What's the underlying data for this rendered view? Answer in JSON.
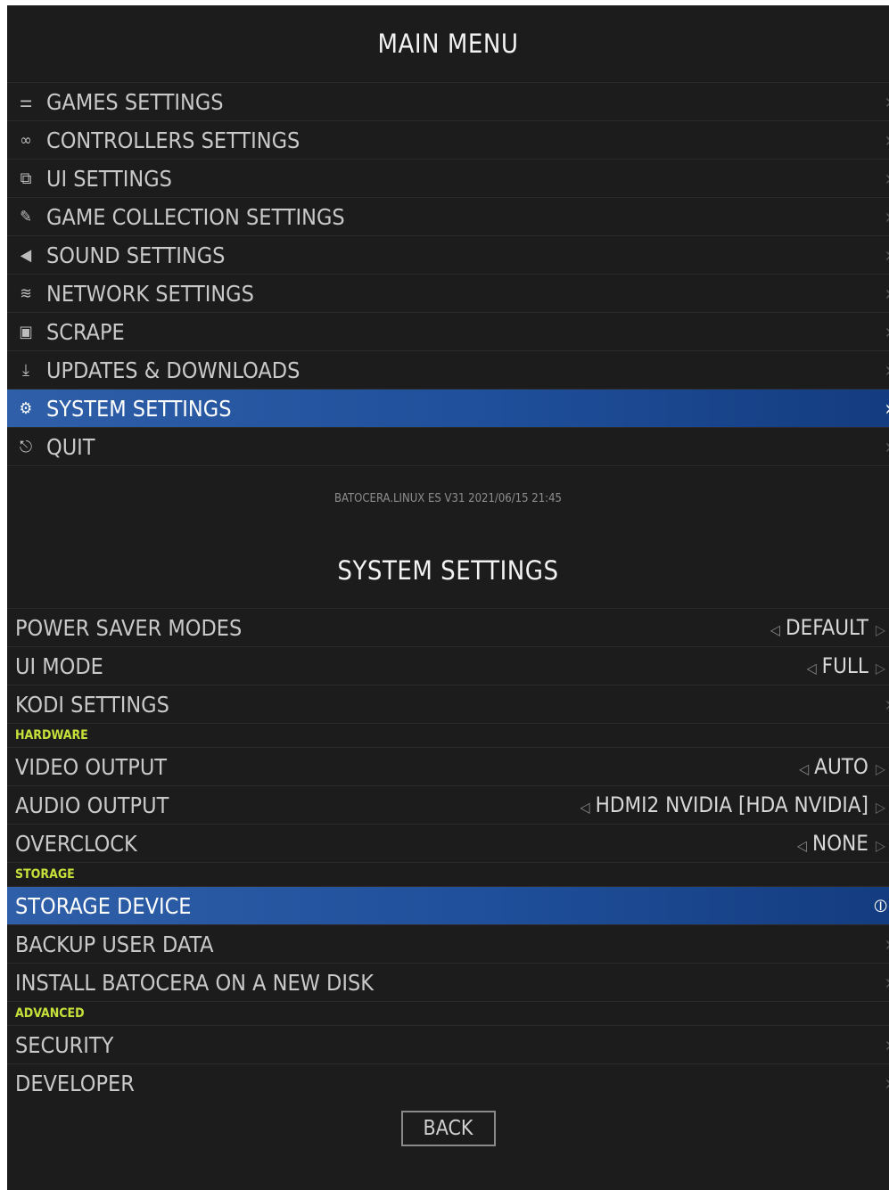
{
  "main_menu": {
    "title": "MAIN MENU",
    "items": [
      {
        "label": "GAMES SETTINGS",
        "icon": "sliders-icon",
        "glyph": "⚌"
      },
      {
        "label": "CONTROLLERS SETTINGS",
        "icon": "gamepad-icon",
        "glyph": "🎮"
      },
      {
        "label": "UI SETTINGS",
        "icon": "ui-icon",
        "glyph": "⧉"
      },
      {
        "label": "GAME COLLECTION SETTINGS",
        "icon": "wrench-icon",
        "glyph": "🔧"
      },
      {
        "label": "SOUND SETTINGS",
        "icon": "speaker-icon",
        "glyph": "🔈"
      },
      {
        "label": "NETWORK SETTINGS",
        "icon": "wifi-icon",
        "glyph": "≋"
      },
      {
        "label": "SCRAPE",
        "icon": "scrape-icon",
        "glyph": "▣"
      },
      {
        "label": "UPDATES & DOWNLOADS",
        "icon": "download-icon",
        "glyph": "⤓"
      },
      {
        "label": "SYSTEM SETTINGS",
        "icon": "gears-icon",
        "glyph": "⚙"
      },
      {
        "label": "QUIT",
        "icon": "quit-icon",
        "glyph": "⎋"
      }
    ],
    "selected_index": 8,
    "chevron": "›",
    "version": "BATOCERA.LINUX ES V31 2021/06/15 21:45"
  },
  "system_settings": {
    "title": "SYSTEM SETTINGS",
    "top_items": [
      {
        "label": "POWER SAVER MODES",
        "value": "DEFAULT"
      },
      {
        "label": "UI MODE",
        "value": "FULL"
      },
      {
        "label": "KODI SETTINGS",
        "value": null
      }
    ],
    "hardware": {
      "label": "HARDWARE",
      "items": [
        {
          "label": "VIDEO OUTPUT",
          "value": "AUTO"
        },
        {
          "label": "AUDIO OUTPUT",
          "value": "HDMI2 NVIDIA [HDA NVIDIA]"
        },
        {
          "label": "OVERCLOCK",
          "value": "NONE"
        }
      ]
    },
    "storage": {
      "label": "STORAGE",
      "items": [
        {
          "label": "STORAGE DEVICE",
          "value": null,
          "selected": true
        },
        {
          "label": "BACKUP USER DATA",
          "value": null
        },
        {
          "label": "INSTALL BATOCERA ON A NEW DISK",
          "value": null
        }
      ]
    },
    "advanced": {
      "label": "ADVANCED",
      "items": [
        {
          "label": "SECURITY",
          "value": null
        },
        {
          "label": "DEVELOPER",
          "value": null
        }
      ]
    },
    "back_label": "BACK"
  },
  "colors": {
    "background": "#1c1c1c",
    "selection": "#2f5fa8",
    "section_header": "#c7e03a"
  }
}
